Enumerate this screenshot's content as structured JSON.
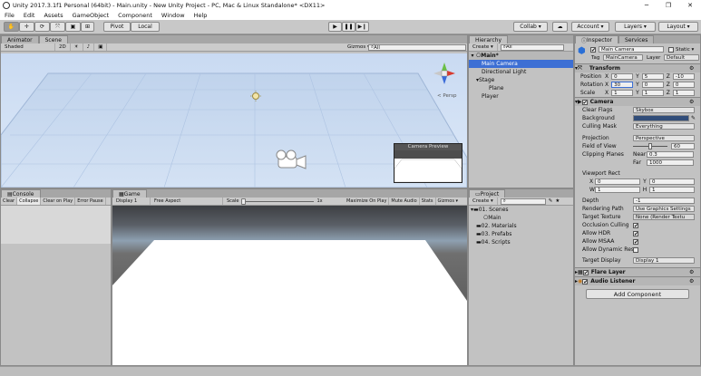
{
  "window": {
    "title": "Unity 2017.3.1f1 Personal (64bit) - Main.unity - New Unity Project - PC, Mac & Linux Standalone* <DX11>",
    "min": "─",
    "max": "❐",
    "close": "✕"
  },
  "menu": [
    "File",
    "Edit",
    "Assets",
    "GameObject",
    "Component",
    "Window",
    "Help"
  ],
  "toolbar": {
    "pivot": "Pivot",
    "local": "Local",
    "collab": "Collab ▾",
    "account": "Account ▾",
    "layers": "Layers ▾",
    "layout": "Layout ▾"
  },
  "scene": {
    "tabs": [
      "Animator",
      "Scene"
    ],
    "shading": "Shaded",
    "mode2d": "2D",
    "gizmos": "Gizmos ▾",
    "search": "All",
    "persp": "< Persp",
    "preview": "Camera Preview"
  },
  "hierarchy": {
    "tab": "Hierarchy",
    "create": "Create ▾",
    "search": "All",
    "scene": "Main*",
    "items": [
      "Main Camera",
      "Directional Light",
      "Stage",
      "Plane",
      "Player"
    ]
  },
  "console": {
    "tab": "Console",
    "buttons": [
      "Clear",
      "Collapse",
      "Clear on Play",
      "Error Pause"
    ]
  },
  "game": {
    "tab": "Game",
    "display": "Display 1",
    "aspect": "Free Aspect",
    "scale_label": "Scale",
    "scale_value": "1x",
    "buttons": [
      "Maximize On Play",
      "Mute Audio",
      "Stats",
      "Gizmos ▾"
    ]
  },
  "project": {
    "tab": "Project",
    "create": "Create ▾",
    "items": [
      "01. Scenes",
      "Main",
      "02. Materials",
      "03. Prefabs",
      "04. Scripts"
    ]
  },
  "inspector": {
    "tabs": [
      "Inspector",
      "Services"
    ],
    "name": "Main Camera",
    "static": "Static ▾",
    "tag_label": "Tag",
    "tag": "MainCamera",
    "layer_label": "Layer",
    "layer": "Default",
    "transform": {
      "title": "Transform",
      "position_label": "Position",
      "rotation_label": "Rotation",
      "scale_label": "Scale",
      "position": [
        "0",
        "5",
        "-10"
      ],
      "rotation": [
        "30",
        "0",
        "0"
      ],
      "scale": [
        "1",
        "1",
        "1"
      ]
    },
    "camera": {
      "title": "Camera",
      "clear_flags_label": "Clear Flags",
      "clear_flags": "Skybox",
      "background_label": "Background",
      "background_color": "#314d79",
      "culling_label": "Culling Mask",
      "culling": "Everything",
      "projection_label": "Projection",
      "projection": "Perspective",
      "fov_label": "Field of View",
      "fov": "60",
      "fov_fraction": 0.5,
      "clipping_label": "Clipping Planes",
      "near_label": "Near",
      "near": "0.3",
      "far_label": "Far",
      "far": "1000",
      "viewport_label": "Viewport Rect",
      "vx": "0",
      "vy": "0",
      "vw": "1",
      "vh": "1",
      "depth_label": "Depth",
      "depth": "-1",
      "rendering_label": "Rendering Path",
      "rendering": "Use Graphics Settings",
      "target_texture_label": "Target Texture",
      "target_texture": "None (Render Textu",
      "occlusion_label": "Occlusion Culling",
      "hdr_label": "Allow HDR",
      "msaa_label": "Allow MSAA",
      "dynres_label": "Allow Dynamic Reso",
      "target_display_label": "Target Display",
      "target_display": "Display 1"
    },
    "flare": "Flare Layer",
    "audio": "Audio Listener",
    "add_component": "Add Component"
  }
}
